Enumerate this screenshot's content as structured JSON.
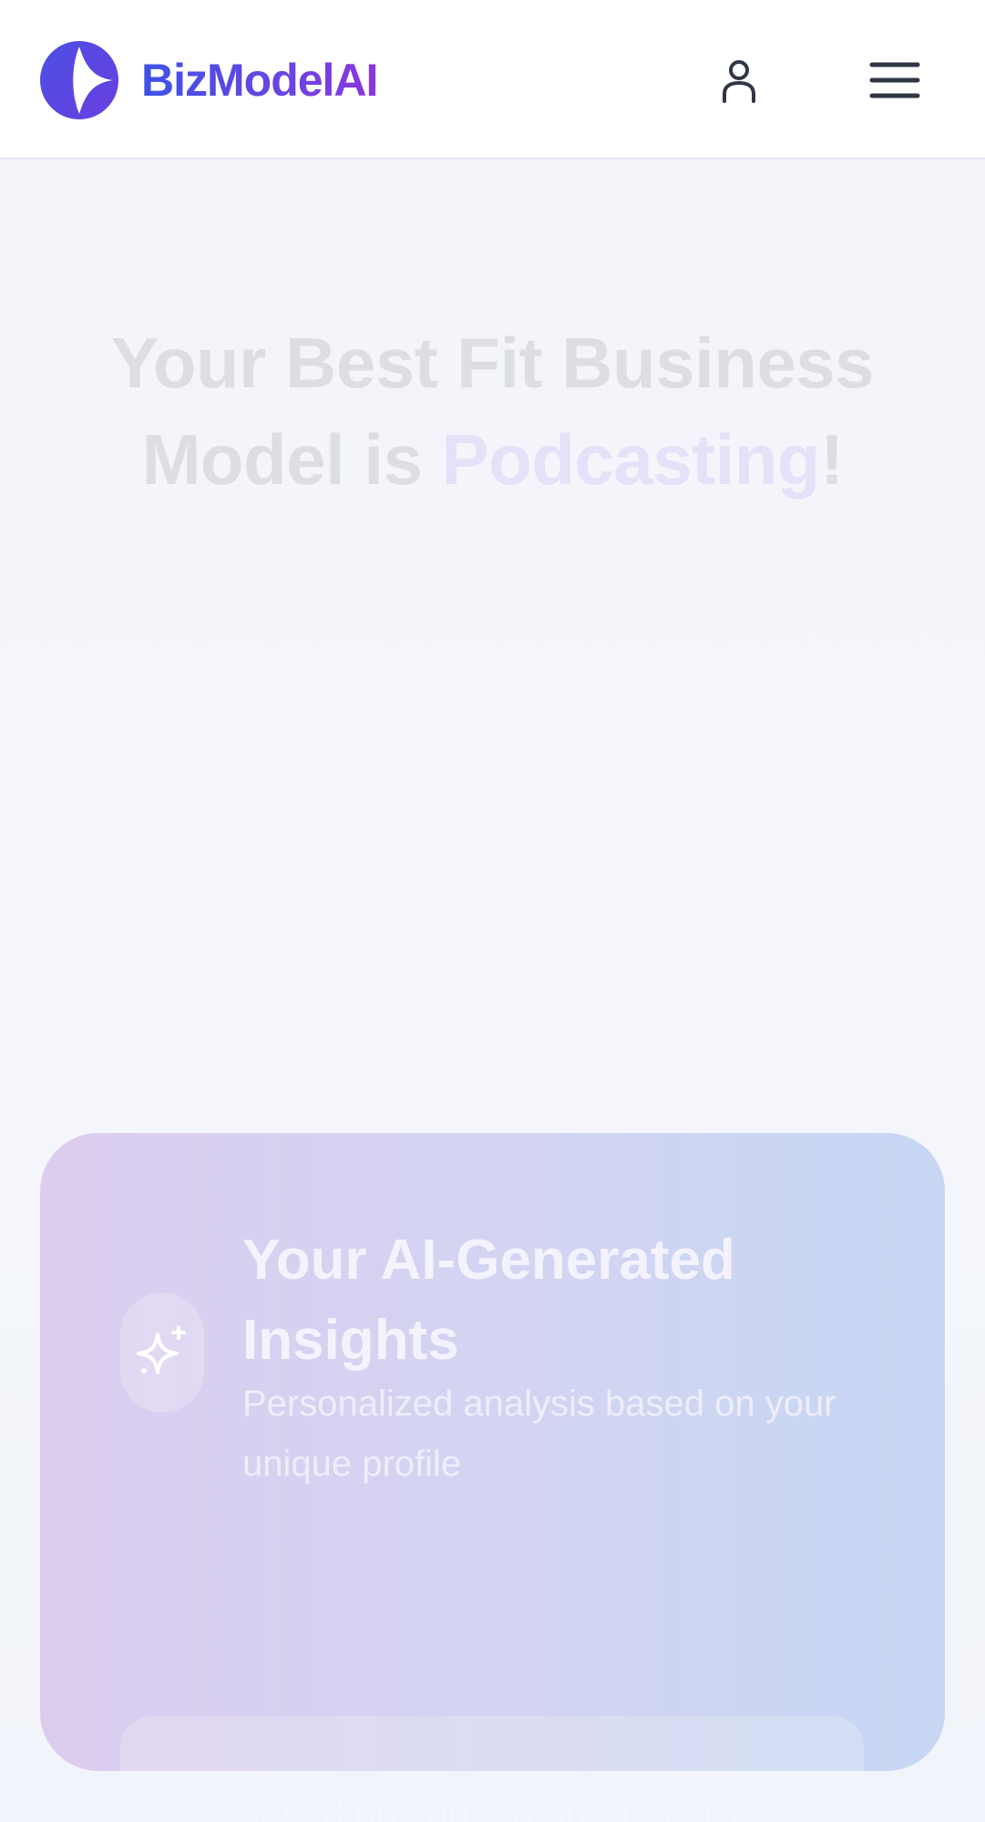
{
  "header": {
    "brand": "BizModelAI",
    "logo_icon": "compass-spark-logo",
    "user_icon": "user-icon",
    "menu_icon": "hamburger-menu-icon",
    "brand_gradient": [
      "#3d53e6",
      "#8a35e0"
    ]
  },
  "hero": {
    "title_prefix": "Your Best Fit Business Model is ",
    "title_highlight": "Podcasting",
    "title_suffix": "!"
  },
  "insights": {
    "icon": "sparkles-icon",
    "title": "Your AI-Generated Insights",
    "subtitle": "Personalized analysis based on your unique profile",
    "body_start": "Based on your comprehensive"
  }
}
